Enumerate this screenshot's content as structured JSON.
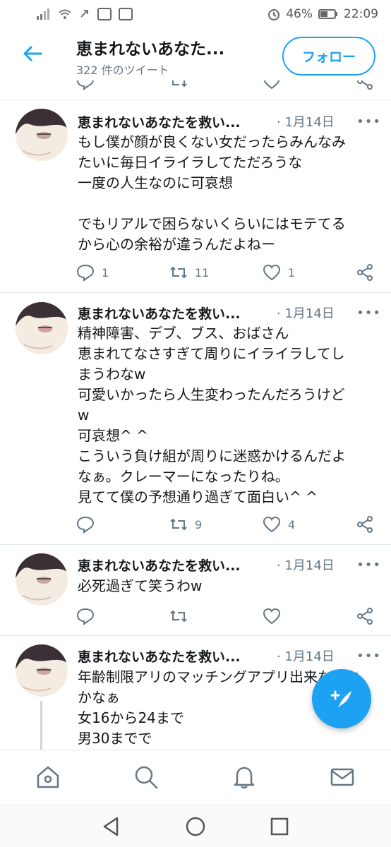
{
  "status_bar": {
    "battery": "46%",
    "time": "22:09"
  },
  "header": {
    "title": "恵まれないあなた...",
    "subtitle": "322 件のツイート",
    "follow_label": "フォロー"
  },
  "tweets": [
    {
      "name": "恵まれないあなたを救い...",
      "date": "· 1月14日",
      "more": "•••",
      "text": "もし僕が顔が良くない女だったらみんなみ\nたいに毎日イライラしてただろうな\n一度の人生なのに可哀想\n\nでもリアルで困らないくらいにはモテてる\nから心の余裕が違うんだよねー",
      "replies": "1",
      "retweets": "11",
      "likes": "1"
    },
    {
      "name": "恵まれないあなたを救い...",
      "date": "· 1月14日",
      "more": "•••",
      "text": "精神障害、デブ、ブス、おばさん\n恵まれてなさすぎて周りにイライラしてし\nまうわなw\n可愛いかったら人生変わったんだろうけど\nw\n可哀想^ ^\nこういう負け組が周りに迷惑かけるんだよ\nなぁ。クレーマーになったりね。\n見てて僕の予想通り過ぎて面白い^ ^",
      "replies": "",
      "retweets": "9",
      "likes": "4"
    },
    {
      "name": "恵まれないあなたを救い...",
      "date": "· 1月14日",
      "more": "•••",
      "text": "必死過ぎて笑うわw",
      "replies": "",
      "retweets": "",
      "likes": ""
    },
    {
      "name": "恵まれないあなたを救い...",
      "date": "· 1月14日",
      "more": "•••",
      "text": "年齢制限アリのマッチングアプリ出来ないか\nかなぁ\n女16から24まで\n男30までで",
      "replies": "",
      "retweets": "",
      "likes": ""
    }
  ],
  "colors": {
    "accent": "#1da1f2",
    "muted": "#657786",
    "text": "#14171a"
  },
  "icons": {
    "back": "arrow-left-icon",
    "reply": "reply-icon",
    "retweet": "retweet-icon",
    "like": "heart-icon",
    "share": "share-icon",
    "compose": "compose-tweet-icon",
    "home": "home-icon",
    "search": "search-icon",
    "notifications": "bell-icon",
    "messages": "mail-icon"
  }
}
